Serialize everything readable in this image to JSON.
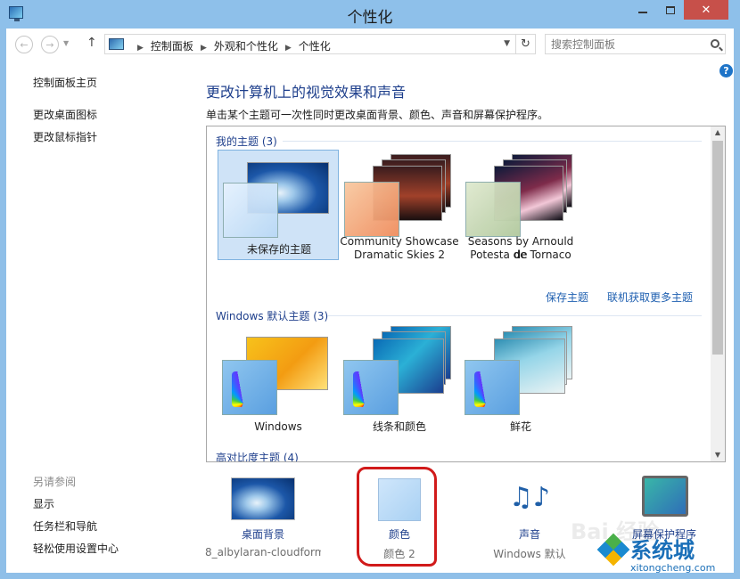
{
  "window": {
    "title": "个性化"
  },
  "address": {
    "crumbs": [
      "控制面板",
      "外观和个性化",
      "个性化"
    ],
    "search_placeholder": "搜索控制面板"
  },
  "left_pane": {
    "home": "控制面板主页",
    "links": [
      "更改桌面图标",
      "更改鼠标指针"
    ],
    "see_also_title": "另请参阅",
    "see_also": [
      "显示",
      "任务栏和导航",
      "轻松使用设置中心"
    ]
  },
  "main": {
    "heading": "更改计算机上的视觉效果和声音",
    "description": "单击某个主题可一次性同时更改桌面背景、颜色、声音和屏幕保护程序。",
    "groups": [
      {
        "title": "我的主题 (3)",
        "themes": [
          {
            "label": "未保存的主题",
            "selected": true
          },
          {
            "label": "Community Showcase Dramatic Skies 2",
            "line1": "Community Showcase",
            "line2": "Dramatic Skies 2"
          },
          {
            "label": "Seasons by Arnould de Potesta de Tornaco",
            "line1": "Seasons by Arnould de",
            "line2": "Potesta de Tornaco"
          }
        ]
      },
      {
        "title": "Windows 默认主题 (3)",
        "themes": [
          {
            "label": "Windows"
          },
          {
            "label": "线条和颜色"
          },
          {
            "label": "鲜花"
          }
        ]
      },
      {
        "title": "高对比度主题 (4)"
      }
    ],
    "actions": {
      "save_theme": "保存主题",
      "get_more": "联机获取更多主题"
    }
  },
  "bottom": [
    {
      "label": "桌面背景",
      "sub": "8_albylaran-cloudform..."
    },
    {
      "label": "颜色",
      "sub": "颜色 2"
    },
    {
      "label": "声音",
      "sub": "Windows 默认"
    },
    {
      "label": "屏幕保护程序",
      "sub": ""
    }
  ],
  "watermark": {
    "main": "系统城",
    "sub": "xitongcheng.com",
    "bg": "Bai 经验"
  },
  "colors": {
    "titlebar": "#8ec0ea",
    "close_button": "#c7504a",
    "link": "#1e5fb0",
    "heading": "#1e3f8c",
    "annotation": "#d11a1a"
  }
}
